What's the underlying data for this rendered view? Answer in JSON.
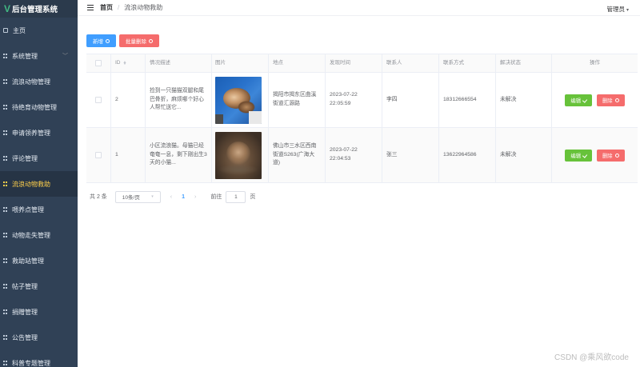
{
  "app": {
    "title": "后台管理系统",
    "logo": "V"
  },
  "sidebar": {
    "items": [
      {
        "label": "主页"
      },
      {
        "label": "系统管理"
      },
      {
        "label": "流浪动物管理"
      },
      {
        "label": "待绝育动物管理"
      },
      {
        "label": "申请领养管理"
      },
      {
        "label": "评论管理"
      },
      {
        "label": "流浪动物救助"
      },
      {
        "label": "喂养点管理"
      },
      {
        "label": "动物走失管理"
      },
      {
        "label": "救助站管理"
      },
      {
        "label": "帖子管理"
      },
      {
        "label": "捐赠管理"
      },
      {
        "label": "公告管理"
      },
      {
        "label": "科普专题管理"
      }
    ]
  },
  "header": {
    "breadcrumb_home": "首页",
    "breadcrumb_separator": "/",
    "breadcrumb_current": "流浪动物救助",
    "user": "管理员"
  },
  "toolbar": {
    "add_label": "新增",
    "batch_delete_label": "批量删除"
  },
  "table": {
    "columns": [
      "ID",
      "情况描述",
      "图片",
      "地点",
      "发现时间",
      "联系人",
      "联系方式",
      "解决状态",
      "操作"
    ],
    "rows": [
      {
        "id": "2",
        "description": "捡到一只猫猫双腿和尾巴骨折，麻烦哪个好心人帮忙送它...",
        "location": "揭阳市揭东区曲溪街道汇源路",
        "time": "2023-07-22 22:05:59",
        "contact": "李四",
        "phone": "18312666554",
        "status": "未解决",
        "edit_label": "编辑",
        "delete_label": "删除"
      },
      {
        "id": "1",
        "description": "小区流浪猫。母猫已经奄奄一息，剩下刚出生3天的小猫...",
        "location": "佛山市三水区西南街道S263(广海大道)",
        "time": "2023-07-22 22:04:53",
        "contact": "张三",
        "phone": "13622964586",
        "status": "未解决",
        "edit_label": "编辑",
        "delete_label": "删除"
      }
    ]
  },
  "pagination": {
    "total": "共 2 条",
    "page_size": "10条/页",
    "current_page": "1",
    "goto_label": "前往",
    "goto_value": "1",
    "page_unit": "页"
  },
  "watermark": "CSDN @乘风欲code",
  "colors": {
    "sidebar_bg": "#304156",
    "active_menu": "#ffd04b",
    "primary": "#409eff",
    "danger": "#f56c6c",
    "success": "#67c23a"
  }
}
